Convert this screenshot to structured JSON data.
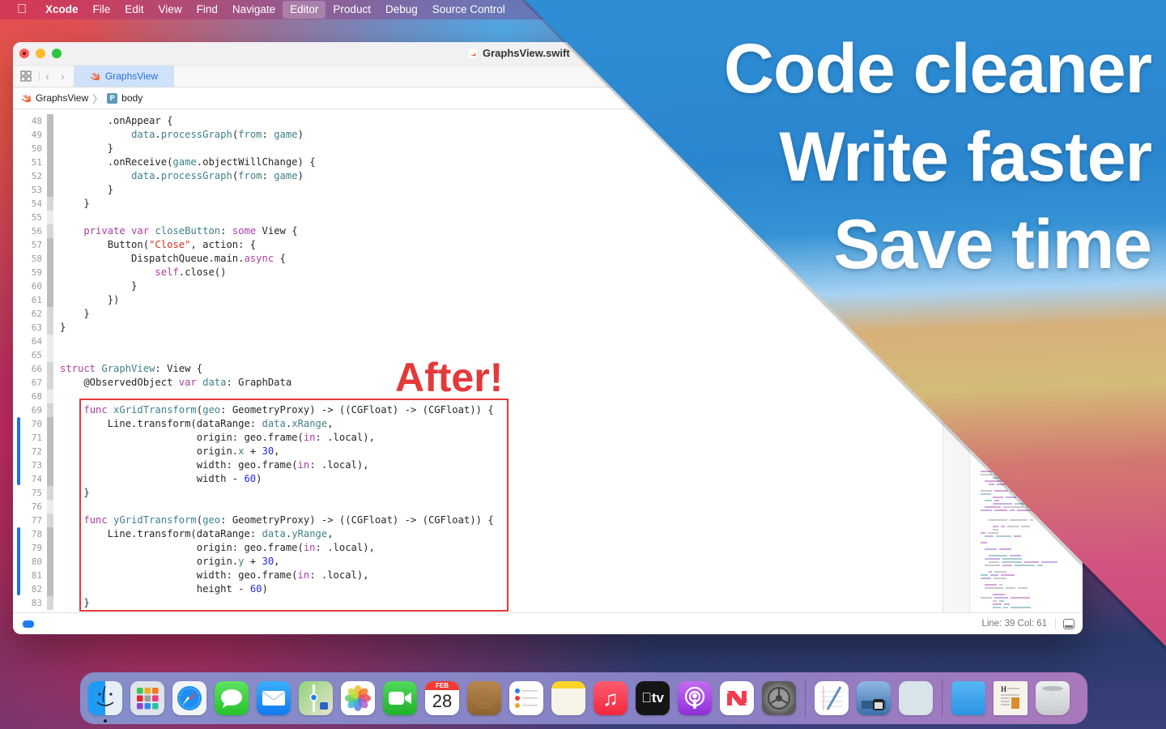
{
  "menubar": {
    "apple_icon": "apple-logo",
    "items": [
      "Xcode",
      "File",
      "Edit",
      "View",
      "Find",
      "Navigate",
      "Editor",
      "Product",
      "Debug",
      "Source Control"
    ],
    "active_item": "Editor"
  },
  "window": {
    "title": "GraphsView.swift",
    "tab_label": "GraphsView",
    "breadcrumb": {
      "file": "GraphsView",
      "symbol_badge": "P",
      "symbol": "body"
    },
    "status": {
      "position": "Line: 39  Col: 61"
    }
  },
  "editor": {
    "after_label": "After!",
    "lines": [
      {
        "n": "48",
        "tokens": [
          [
            "p",
            "        .onAppear {"
          ]
        ]
      },
      {
        "n": "49",
        "tokens": [
          [
            "p",
            "            "
          ],
          [
            "f",
            "data"
          ],
          [
            "p",
            "."
          ],
          [
            "f",
            "processGraph"
          ],
          [
            "p",
            "("
          ],
          [
            "f",
            "from"
          ],
          [
            "p",
            ": "
          ],
          [
            "f",
            "game"
          ],
          [
            "p",
            ")"
          ]
        ]
      },
      {
        "n": "50",
        "tokens": [
          [
            "p",
            "        }"
          ]
        ]
      },
      {
        "n": "51",
        "tokens": [
          [
            "p",
            "        .onReceive("
          ],
          [
            "f",
            "game"
          ],
          [
            "p",
            ".objectWillChange) {"
          ]
        ]
      },
      {
        "n": "52",
        "tokens": [
          [
            "p",
            "            "
          ],
          [
            "f",
            "data"
          ],
          [
            "p",
            "."
          ],
          [
            "f",
            "processGraph"
          ],
          [
            "p",
            "("
          ],
          [
            "f",
            "from"
          ],
          [
            "p",
            ": "
          ],
          [
            "f",
            "game"
          ],
          [
            "p",
            ")"
          ]
        ]
      },
      {
        "n": "53",
        "tokens": [
          [
            "p",
            "        }"
          ]
        ]
      },
      {
        "n": "54",
        "tokens": [
          [
            "p",
            "    }"
          ]
        ]
      },
      {
        "n": "55",
        "tokens": [
          [
            "p",
            ""
          ]
        ]
      },
      {
        "n": "56",
        "tokens": [
          [
            "p",
            "    "
          ],
          [
            "k",
            "private var "
          ],
          [
            "t",
            "closeButton"
          ],
          [
            "p",
            ": "
          ],
          [
            "k",
            "some"
          ],
          [
            "p",
            " View {"
          ]
        ]
      },
      {
        "n": "57",
        "tokens": [
          [
            "p",
            "        Button("
          ],
          [
            "s",
            "\"Close\""
          ],
          [
            "p",
            ", action: {"
          ]
        ]
      },
      {
        "n": "58",
        "tokens": [
          [
            "p",
            "            DispatchQueue.main."
          ],
          [
            "k",
            "async"
          ],
          [
            "p",
            " {"
          ]
        ]
      },
      {
        "n": "59",
        "tokens": [
          [
            "p",
            "                "
          ],
          [
            "k",
            "self"
          ],
          [
            "p",
            ".close()"
          ]
        ]
      },
      {
        "n": "60",
        "tokens": [
          [
            "p",
            "            }"
          ]
        ]
      },
      {
        "n": "61",
        "tokens": [
          [
            "p",
            "        })"
          ]
        ]
      },
      {
        "n": "62",
        "tokens": [
          [
            "p",
            "    }"
          ]
        ]
      },
      {
        "n": "63",
        "tokens": [
          [
            "p",
            "}"
          ]
        ]
      },
      {
        "n": "64",
        "tokens": [
          [
            "p",
            ""
          ]
        ]
      },
      {
        "n": "65",
        "tokens": [
          [
            "p",
            ""
          ]
        ]
      },
      {
        "n": "66",
        "tokens": [
          [
            "k",
            "struct "
          ],
          [
            "t",
            "GraphView"
          ],
          [
            "p",
            ": View {"
          ]
        ]
      },
      {
        "n": "67",
        "tokens": [
          [
            "p",
            "    @ObservedObject "
          ],
          [
            "k",
            "var "
          ],
          [
            "t",
            "data"
          ],
          [
            "p",
            ": GraphData"
          ]
        ]
      },
      {
        "n": "68",
        "tokens": [
          [
            "p",
            ""
          ]
        ]
      },
      {
        "n": "69",
        "tokens": [
          [
            "p",
            "    "
          ],
          [
            "k",
            "func "
          ],
          [
            "t",
            "xGridTransform"
          ],
          [
            "p",
            "("
          ],
          [
            "t",
            "geo"
          ],
          [
            "p",
            ": GeometryProxy) -> ((CGFloat) -> (CGFloat)) {"
          ]
        ]
      },
      {
        "n": "70",
        "tokens": [
          [
            "p",
            "        Line.transform(dataRange: "
          ],
          [
            "f",
            "data"
          ],
          [
            "p",
            "."
          ],
          [
            "f",
            "xRange"
          ],
          [
            "p",
            ","
          ]
        ]
      },
      {
        "n": "71",
        "tokens": [
          [
            "p",
            "                       origin: geo.frame("
          ],
          [
            "k",
            "in"
          ],
          [
            "p",
            ": .local),"
          ]
        ]
      },
      {
        "n": "72",
        "tokens": [
          [
            "p",
            "                       origin."
          ],
          [
            "f",
            "x"
          ],
          [
            "p",
            " + "
          ],
          [
            "n",
            "30"
          ],
          [
            "p",
            ","
          ]
        ]
      },
      {
        "n": "73",
        "tokens": [
          [
            "p",
            "                       width: geo.frame("
          ],
          [
            "k",
            "in"
          ],
          [
            "p",
            ": .local),"
          ]
        ]
      },
      {
        "n": "74",
        "tokens": [
          [
            "p",
            "                       width - "
          ],
          [
            "n",
            "60"
          ],
          [
            "p",
            ")"
          ]
        ]
      },
      {
        "n": "75",
        "tokens": [
          [
            "p",
            "    }"
          ]
        ]
      },
      {
        "n": "76",
        "tokens": [
          [
            "p",
            ""
          ]
        ]
      },
      {
        "n": "77",
        "tokens": [
          [
            "p",
            "    "
          ],
          [
            "k",
            "func "
          ],
          [
            "t",
            "yGridTransform"
          ],
          [
            "p",
            "("
          ],
          [
            "t",
            "geo"
          ],
          [
            "p",
            ": GeometryProxy) -> ((CGFloat) -> (CGFloat)) {"
          ]
        ]
      },
      {
        "n": "78",
        "tokens": [
          [
            "p",
            "        Line.transform(dataRange: "
          ],
          [
            "f",
            "data"
          ],
          [
            "p",
            "."
          ],
          [
            "f",
            "yRange"
          ],
          [
            "p",
            ","
          ]
        ]
      },
      {
        "n": "79",
        "tokens": [
          [
            "p",
            "                       origin: geo.frame("
          ],
          [
            "k",
            "in"
          ],
          [
            "p",
            ": .local),"
          ]
        ]
      },
      {
        "n": "80",
        "tokens": [
          [
            "p",
            "                       origin."
          ],
          [
            "f",
            "y"
          ],
          [
            "p",
            " + "
          ],
          [
            "n",
            "30"
          ],
          [
            "p",
            ","
          ]
        ]
      },
      {
        "n": "81",
        "tokens": [
          [
            "p",
            "                       width: geo.frame("
          ],
          [
            "k",
            "in"
          ],
          [
            "p",
            ": .local),"
          ]
        ]
      },
      {
        "n": "82",
        "tokens": [
          [
            "p",
            "                       height - "
          ],
          [
            "n",
            "60"
          ],
          [
            "p",
            ")"
          ]
        ]
      },
      {
        "n": "83",
        "tokens": [
          [
            "p",
            "    }"
          ]
        ]
      }
    ]
  },
  "headline": {
    "line1": "Code cleaner",
    "line2": "Write faster",
    "line3": "Save time"
  },
  "dock": {
    "items": [
      {
        "name": "finder",
        "label": "Finder",
        "running": true
      },
      {
        "name": "launchpad",
        "label": "Launchpad"
      },
      {
        "name": "safari",
        "label": "Safari"
      },
      {
        "name": "messages",
        "label": "Messages"
      },
      {
        "name": "mail",
        "label": "Mail"
      },
      {
        "name": "maps",
        "label": "Maps"
      },
      {
        "name": "photos",
        "label": "Photos"
      },
      {
        "name": "facetime",
        "label": "FaceTime"
      },
      {
        "name": "calendar",
        "label": "Calendar",
        "month": "FEB",
        "day": "28"
      },
      {
        "name": "contacts",
        "label": "Contacts"
      },
      {
        "name": "reminders",
        "label": "Reminders"
      },
      {
        "name": "notes",
        "label": "Notes"
      },
      {
        "name": "music",
        "label": "Music"
      },
      {
        "name": "tv",
        "label": "TV",
        "text": "tv"
      },
      {
        "name": "podcasts",
        "label": "Podcasts"
      },
      {
        "name": "news",
        "label": "News"
      },
      {
        "name": "system-preferences",
        "label": "System Preferences"
      },
      {
        "divider": true
      },
      {
        "name": "textedit",
        "label": "TextEdit"
      },
      {
        "name": "preview",
        "label": "Preview"
      },
      {
        "name": "blank-app",
        "label": "App"
      },
      {
        "divider": true
      },
      {
        "name": "downloads-folder",
        "label": "Folder"
      },
      {
        "name": "document",
        "label": "Document"
      },
      {
        "name": "trash",
        "label": "Trash"
      }
    ]
  },
  "colors": {
    "accent": "#1a73e8",
    "after_red": "#e3393a",
    "keyword": "#ad3da4",
    "type": "#3e8087",
    "string": "#d12f1b",
    "number": "#272ad8"
  }
}
